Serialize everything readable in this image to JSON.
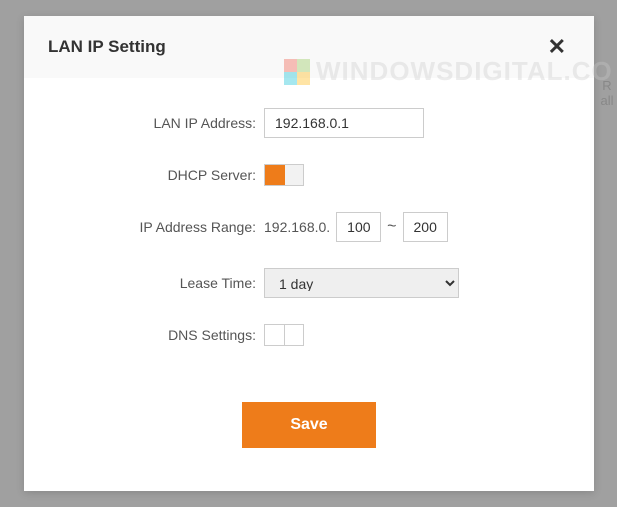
{
  "modal": {
    "title": "LAN IP Setting",
    "close_symbol": "✕"
  },
  "form": {
    "lan_ip_label": "LAN IP Address:",
    "lan_ip_value": "192.168.0.1",
    "dhcp_label": "DHCP Server:",
    "dhcp_on": true,
    "range_label": "IP Address Range:",
    "range_prefix": "192.168.0.",
    "range_start": "100",
    "range_sep": "~",
    "range_end": "200",
    "lease_label": "Lease Time:",
    "lease_value": "1 day",
    "dns_label": "DNS Settings:",
    "dns_on": false,
    "save_label": "Save"
  },
  "watermark": {
    "text": "WINDOWSDIGITAL.CO"
  },
  "bg": {
    "line1": "R",
    "line2": "all"
  }
}
